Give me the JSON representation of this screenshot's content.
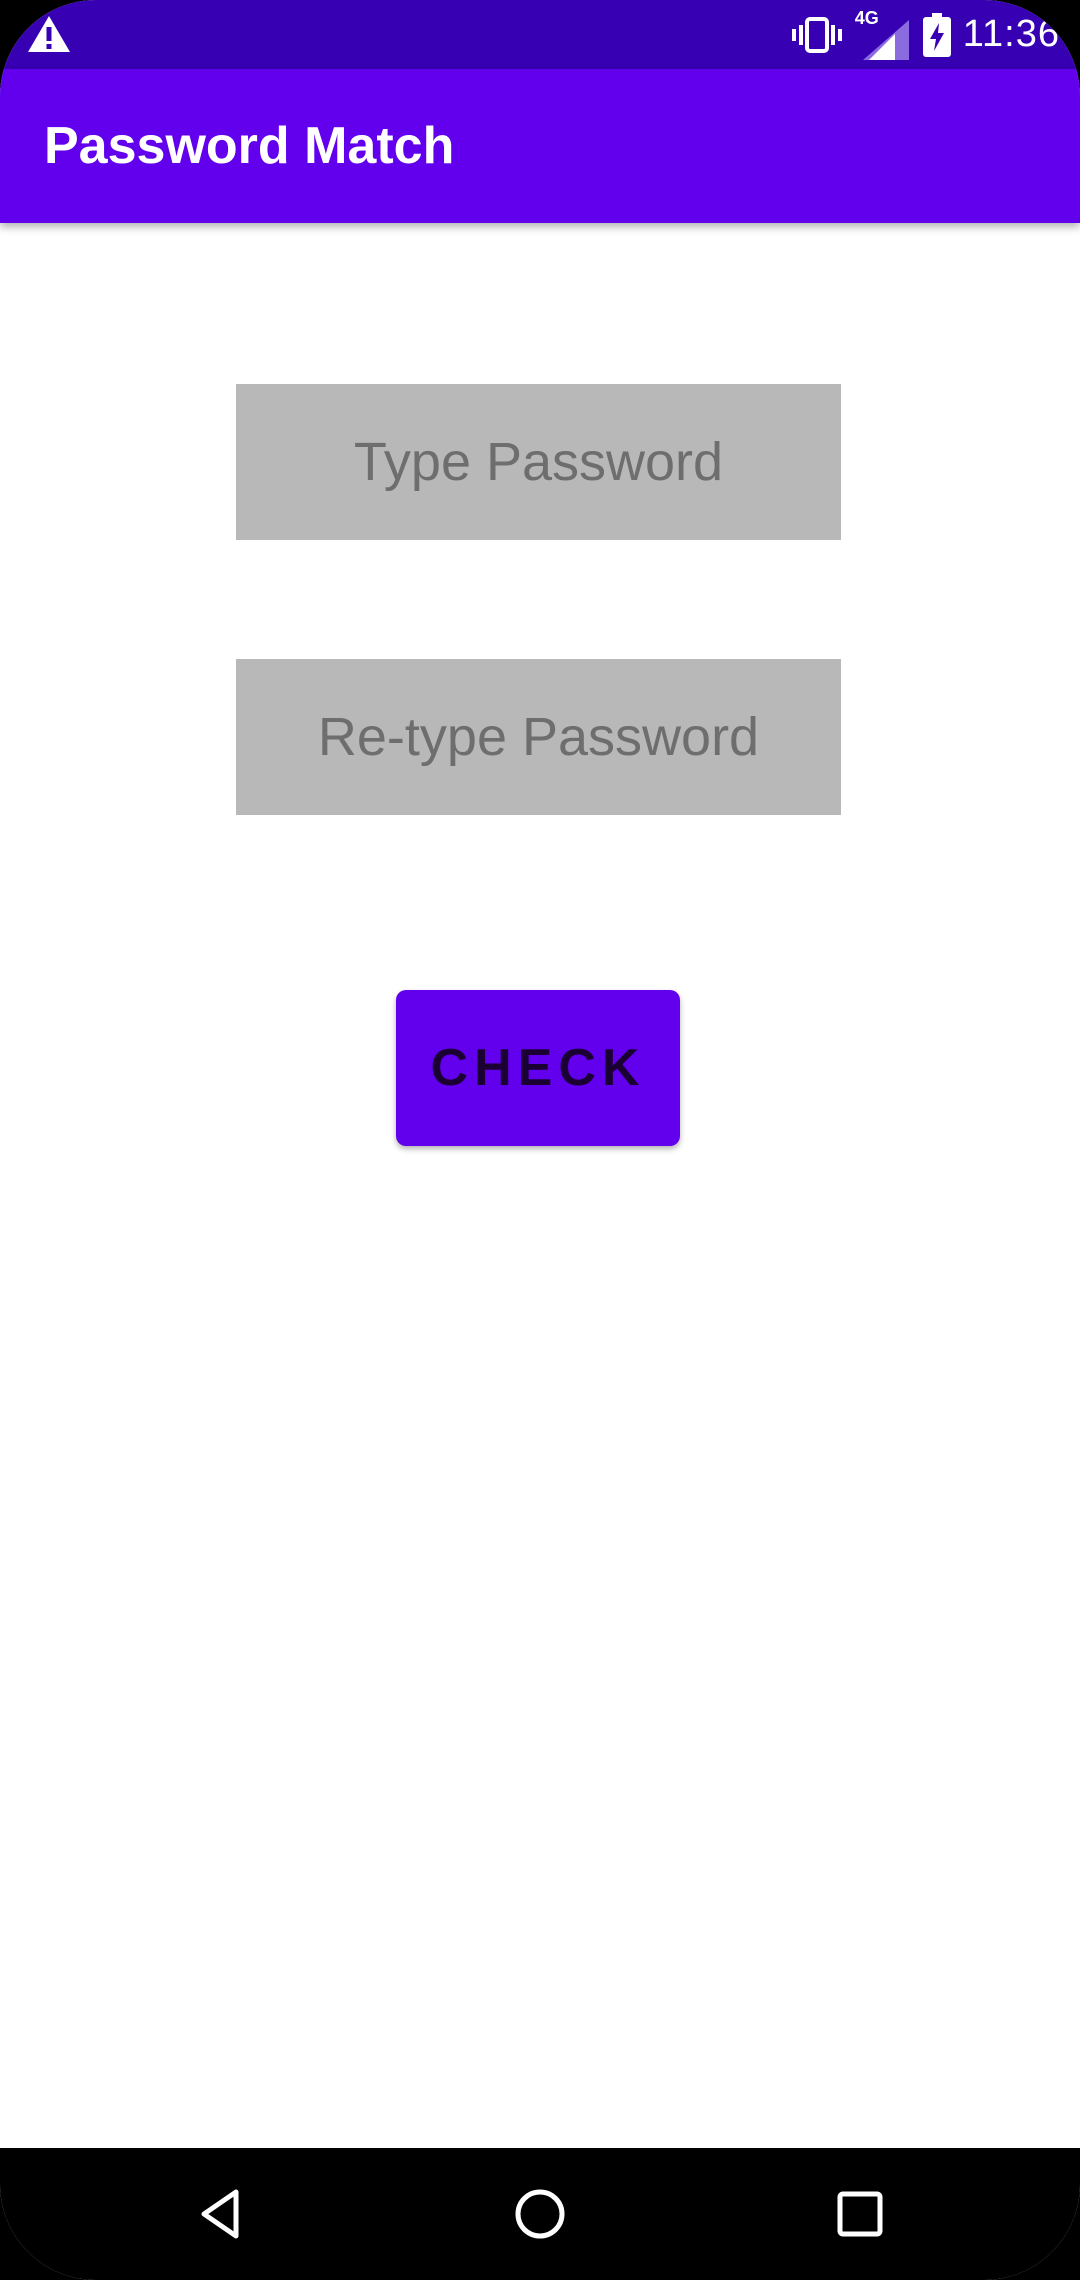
{
  "status_bar": {
    "time": "11:36",
    "network": "4G",
    "icons": [
      "warning-icon",
      "vibrate-icon",
      "signal-icon",
      "battery-charging-icon"
    ]
  },
  "app_bar": {
    "title": "Password Match"
  },
  "form": {
    "password_placeholder": "Type Password",
    "password_value": "",
    "retype_placeholder": "Re-type Password",
    "retype_value": "",
    "check_label": "CHECK"
  },
  "nav_bar": {
    "icons": [
      "back-icon",
      "home-icon",
      "recent-apps-icon"
    ]
  },
  "colors": {
    "status_bar": "#3700b3",
    "primary": "#6200ee",
    "field_bg": "#b8b8b8",
    "background": "#ffffff"
  }
}
